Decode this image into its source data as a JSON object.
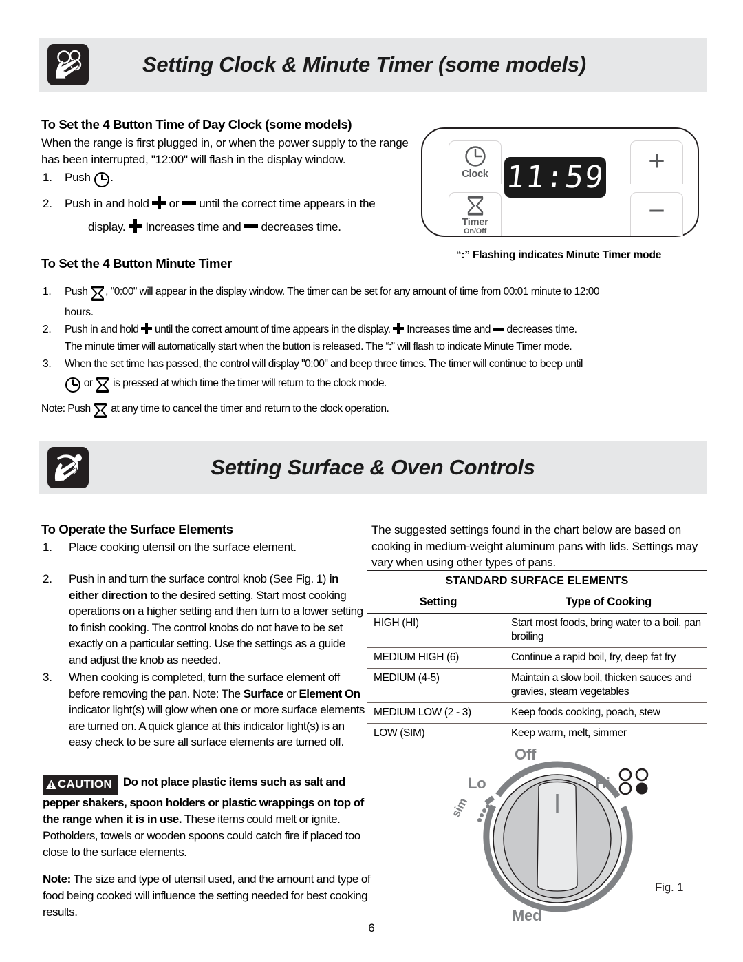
{
  "sections": [
    {
      "banner_title": "Setting Clock & Minute Timer (some models)",
      "icon": "hand-pressing-buttons-icon"
    },
    {
      "banner_title": "Setting Surface & Oven Controls",
      "icon": "hand-turning-knob-icon"
    }
  ],
  "clock": {
    "heading": "To Set the 4 Button Time of Day Clock (some models)",
    "intro": "When the range is first plugged in, or when the power supply to the range has been interrupted, \"12:00\" will flash in the display window.",
    "steps": [
      {
        "num": "1.",
        "a": "Push",
        "b": "."
      },
      {
        "num": "2.",
        "a": "Push in and hold",
        "b": "or",
        "c": "until the correct time appears in the",
        "d": "display.",
        "e": "Increases time and",
        "f": "decreases time."
      }
    ]
  },
  "panel": {
    "clock_key_label": "Clock",
    "timer_key_label": "Timer",
    "timer_key_sublabel": "On/Off",
    "display_value": "11:59",
    "plus_label": "+",
    "minus_label": "−",
    "caption": "“:” Flashing indicates Minute Timer mode"
  },
  "timer": {
    "heading": "To Set the 4 Button Minute Timer",
    "steps": [
      {
        "num": "1.",
        "a": "Push",
        "b": ", \"0:00\" will appear in the display window. The timer can be set for any amount of time from 00:01 minute to 12:00",
        "c": "hours."
      },
      {
        "num": "2.",
        "a": "Push in and hold",
        "b": "until the correct amount of time appears in the display.",
        "c": "Increases time and",
        "d": "decreases time.",
        "e": "The minute timer will automatically start when the button is released. The “:” will flash to indicate Minute Timer mode."
      },
      {
        "num": "3.",
        "a": "When the set time has passed, the control will display \"0:00\" and beep three times. The timer will continue to beep until",
        "b": "or",
        "c": "is pressed at which time the timer will return to the clock mode."
      }
    ],
    "note_a": "Note: Push",
    "note_b": "at any time to cancel the timer and return to the clock operation."
  },
  "surface": {
    "heading": "To Operate the Surface Elements",
    "steps": [
      {
        "num": "1.",
        "text": "Place cooking utensil on the surface element."
      },
      {
        "num": "2.",
        "t1": "Push in and turn the surface control knob (See Fig. 1) ",
        "bold1": "in either direction",
        "t2": " to the desired setting. Start most cooking operations on a higher setting and then turn to a lower setting to finish cooking. The control knobs do not have to be set exactly on a particular setting. Use the settings as a guide and adjust the knob as needed."
      },
      {
        "num": "3.",
        "t1": "When cooking is completed, turn the surface element off before removing the pan. Note: The ",
        "bold1": "Surface",
        "t2": " or ",
        "bold2": "Element On",
        "t3": " indicator light(s) will glow when one or more surface elements are turned on. A quick glance at this indicator light(s) is an easy check to be sure all surface elements are turned off."
      }
    ],
    "intro_right": "The suggested settings found in the chart below are based on cooking in medium-weight aluminum pans with lids. Settings may vary when using other types of pans."
  },
  "caution": {
    "badge": "CAUTION",
    "bold1": "Do not place plastic items such as salt and pepper shakers, spoon holders or plastic wrappings on top of the range when it is in use.",
    "rest": " These items could melt or ignite. Potholders, towels or wooden spoons could catch fire if placed too close to the surface elements."
  },
  "note": {
    "bold": "Note:",
    "rest": " The size and type of utensil used, and the amount and type of food being cooked will influence the setting needed for best cooking results."
  },
  "table": {
    "title": "STANDARD SURFACE ELEMENTS",
    "columns": [
      "Setting",
      "Type of Cooking"
    ],
    "rows": [
      {
        "setting": "HIGH (HI)",
        "cooking": "Start most foods, bring water to a boil, pan broiling"
      },
      {
        "setting": "MEDIUM HIGH (6)",
        "cooking": "Continue a rapid boil, fry, deep fat fry"
      },
      {
        "setting": "MEDIUM (4-5)",
        "cooking": "Maintain a slow boil, thicken sauces and gravies, steam vegetables"
      },
      {
        "setting": "MEDIUM LOW (2 - 3)",
        "cooking": "Keep foods cooking, poach, stew"
      },
      {
        "setting": "LOW (SIM)",
        "cooking": "Keep warm, melt, simmer"
      }
    ]
  },
  "knob": {
    "off": "Off",
    "lo": "Lo",
    "sim": "sim",
    "hi": "Hi",
    "med": "Med",
    "fig": "Fig. 1"
  },
  "page_number": "6",
  "colors": {
    "banner_bg": "#e6e7e8",
    "icon_box": "#231f20",
    "display_bg": "#1b1b1b",
    "knob_gray": "#808285",
    "text": "#000000"
  }
}
